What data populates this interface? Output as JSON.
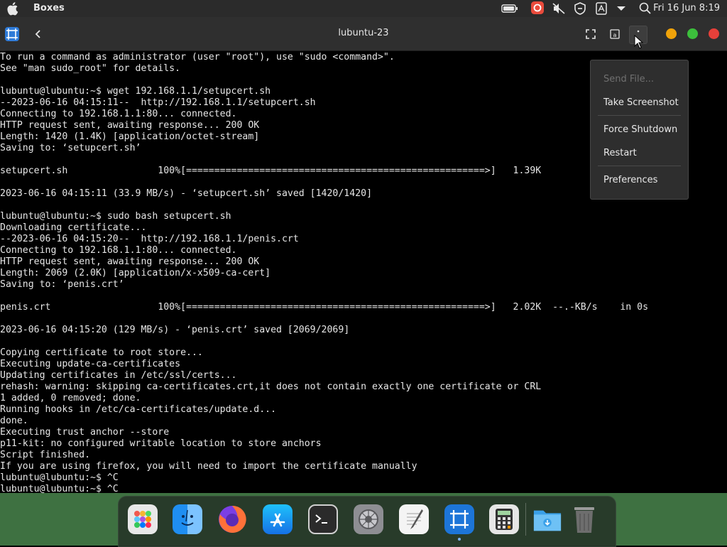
{
  "topbar": {
    "app_name": "Boxes",
    "clock": "Fri 16 Jun 8:19",
    "icons": [
      "apple-logo-icon",
      "battery-icon",
      "app-indicator-icon",
      "mute-icon",
      "shield-icon",
      "document-icon",
      "chevron-down-icon",
      "search-icon"
    ]
  },
  "header": {
    "title": "lubuntu-23",
    "buttons": [
      "back-icon",
      "fullscreen-icon",
      "keyboard-icon",
      "menu-icon"
    ],
    "window_controls": {
      "minimize": "#f0a30a",
      "maximize": "#3cbf3c",
      "close": "#e6403a"
    }
  },
  "terminal": {
    "lines": [
      "To run a command as administrator (user \"root\"), use \"sudo <command>\".",
      "See \"man sudo_root\" for details.",
      "",
      "lubuntu@lubuntu:~$ wget 192.168.1.1/setupcert.sh",
      "--2023-06-16 04:15:11--  http://192.168.1.1/setupcert.sh",
      "Connecting to 192.168.1.1:80... connected.",
      "HTTP request sent, awaiting response... 200 OK",
      "Length: 1420 (1.4K) [application/octet-stream]",
      "Saving to: ‘setupcert.sh’",
      "",
      "setupcert.sh                100%[=====================================================>]   1.39K",
      "",
      "2023-06-16 04:15:11 (33.9 MB/s) - ‘setupcert.sh’ saved [1420/1420]",
      "",
      "lubuntu@lubuntu:~$ sudo bash setupcert.sh",
      "Downloading certificate...",
      "--2023-06-16 04:15:20--  http://192.168.1.1/penis.crt",
      "Connecting to 192.168.1.1:80... connected.",
      "HTTP request sent, awaiting response... 200 OK",
      "Length: 2069 (2.0K) [application/x-x509-ca-cert]",
      "Saving to: ‘penis.crt’",
      "",
      "penis.crt                   100%[=====================================================>]   2.02K  --.-KB/s    in 0s",
      "",
      "2023-06-16 04:15:20 (129 MB/s) - ‘penis.crt’ saved [2069/2069]",
      "",
      "Copying certificate to root store...",
      "Executing update-ca-certificates",
      "Updating certificates in /etc/ssl/certs...",
      "rehash: warning: skipping ca-certificates.crt,it does not contain exactly one certificate or CRL",
      "1 added, 0 removed; done.",
      "Running hooks in /etc/ca-certificates/update.d...",
      "done.",
      "Executing trust anchor --store",
      "p11-kit: no configured writable location to store anchors",
      "Script finished.",
      "If you are using firefox, you will need to import the certificate manually",
      "lubuntu@lubuntu:~$ ^C",
      "lubuntu@lubuntu:~$ ^C"
    ]
  },
  "menu": {
    "items": [
      {
        "label": "Send File...",
        "enabled": false
      },
      {
        "label": "Take Screenshot",
        "enabled": true
      },
      {
        "label": "Force Shutdown",
        "enabled": true
      },
      {
        "label": "Restart",
        "enabled": true
      },
      {
        "label": "Preferences",
        "enabled": true
      }
    ]
  },
  "dock": {
    "apps": [
      "launchpad-icon",
      "finder-icon",
      "firefox-icon",
      "app-store-icon",
      "terminal-icon",
      "system-settings-icon",
      "text-editor-icon",
      "boxes-icon",
      "calculator-icon",
      "downloads-folder-icon",
      "trash-icon"
    ],
    "active_app": "boxes-icon"
  }
}
